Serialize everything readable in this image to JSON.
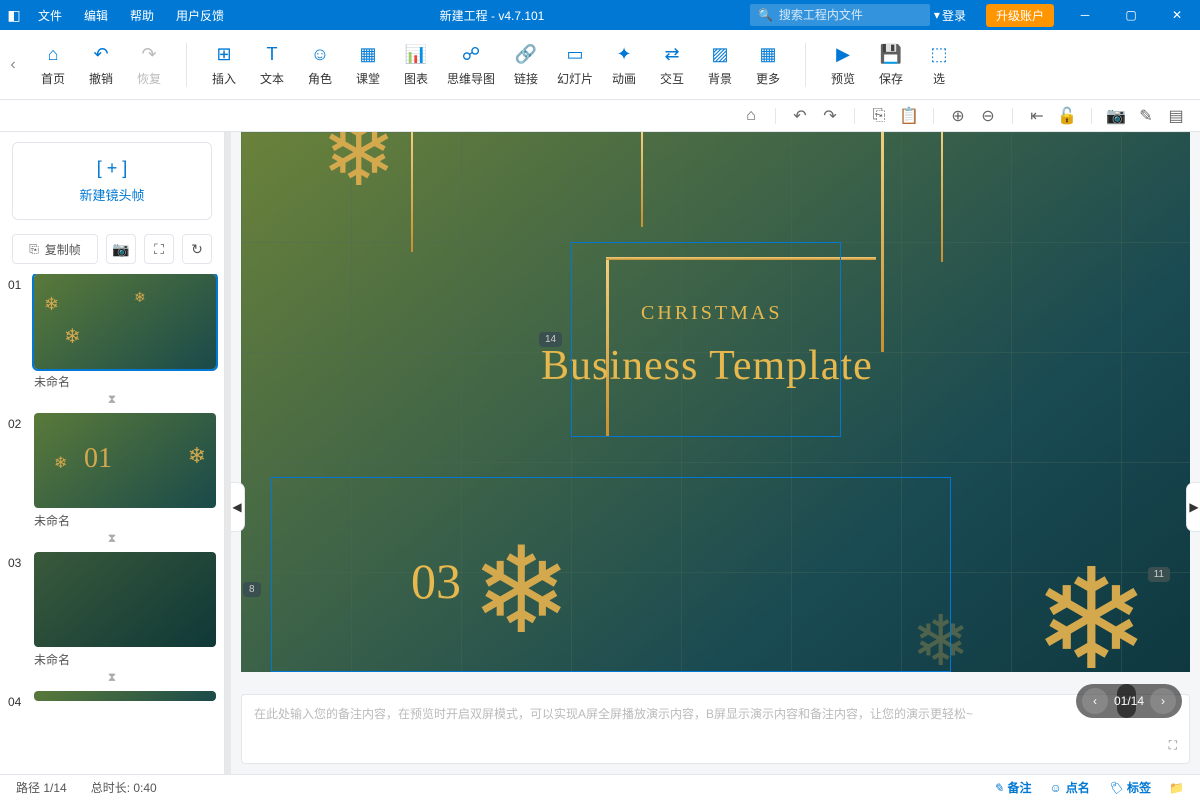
{
  "titlebar": {
    "menus": [
      "文件",
      "编辑",
      "帮助",
      "用户反馈"
    ],
    "title": "新建工程 - v4.7.101",
    "search_placeholder": "搜索工程内文件",
    "login": "登录",
    "upgrade": "升级账户"
  },
  "ribbon": {
    "home": "首页",
    "undo": "撤销",
    "redo": "恢复",
    "insert": "插入",
    "text": "文本",
    "role": "角色",
    "class": "课堂",
    "chart": "图表",
    "mindmap": "思维导图",
    "link": "链接",
    "slide": "幻灯片",
    "anim": "动画",
    "interact": "交互",
    "bg": "背景",
    "more": "更多",
    "preview": "预览",
    "save": "保存",
    "select": "选"
  },
  "sidebar": {
    "newframe": "新建镜头帧",
    "copy": "复制帧",
    "frames": [
      {
        "num": "01",
        "name": "未命名"
      },
      {
        "num": "02",
        "name": "未命名"
      },
      {
        "num": "03",
        "name": "未命名"
      },
      {
        "num": "04",
        "name": ""
      }
    ]
  },
  "canvas": {
    "subtitle": "CHRISTMAS",
    "title": "Business Template",
    "num": "03",
    "badge1": "14",
    "badge2": "8",
    "badge3": "11"
  },
  "notes": {
    "placeholder": "在此处输入您的备注内容，在预览时开启双屏模式，可以实现A屏全屏播放演示内容，B屏显示演示内容和备注内容，让您的演示更轻松~"
  },
  "pager": {
    "text": "01/14"
  },
  "status": {
    "path": "路径 1/14",
    "duration": "总时长: 0:40",
    "notes_btn": "备注",
    "like": "点名",
    "tag": "标签"
  }
}
